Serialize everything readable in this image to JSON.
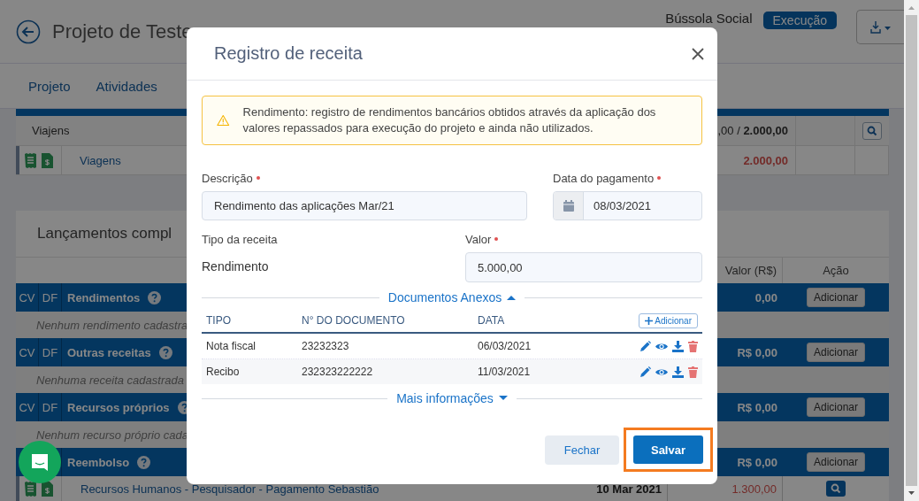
{
  "header": {
    "title": "Projeto de Teste",
    "organization": "Bússola Social",
    "status_badge": "Execução"
  },
  "tabs": [
    {
      "label": "Projeto",
      "selected": false
    },
    {
      "label": "Atividades",
      "selected": false
    }
  ],
  "budget_rows": [
    {
      "kind": "group",
      "label": "Viajens",
      "amount": ",00 / **2.000,00**"
    },
    {
      "kind": "item",
      "label": "Viagens",
      "amount": "2.000,00"
    }
  ],
  "launches": {
    "title": "Lançamentos compl",
    "columns": [
      "Valor (R$)",
      "Ação"
    ],
    "sections": [
      {
        "codes": [
          "CV",
          "DF"
        ],
        "name": "Rendimentos",
        "total": "0,00",
        "action": "Adicionar",
        "empty_text": "Nenhum rendimento cadastra"
      },
      {
        "codes": [
          "CV",
          "DF"
        ],
        "name": "Outras receitas",
        "total": "R$ 0,00",
        "action": "Adicionar",
        "empty_text": "Nenhuma receita cadastrada"
      },
      {
        "codes": [
          "CV",
          "DF"
        ],
        "name": "Recursos próprios",
        "total": "R$ 0,00",
        "action": "Adicionar",
        "empty_text": "Nenhum recurso próprio cada"
      },
      {
        "name": "Reembolso",
        "total": "R$ 0,00",
        "action": "Adicionar",
        "entries": [
          {
            "description": "Recursos Humanos - Pesquisador - Pagamento Sebastião",
            "date": "10 Mar 2021",
            "amount": "1.300,00"
          }
        ]
      }
    ]
  },
  "modal": {
    "title": "Registro de receita",
    "alert": "Rendimento: registro de rendimentos bancários obtidos através da aplicação dos valores repassados para execução do projeto e ainda não utilizados.",
    "description": {
      "label": "Descrição",
      "required": true,
      "value": "Rendimento das aplicações Mar/21"
    },
    "payment_date": {
      "label": "Data do pagamento",
      "required": true,
      "value": "08/03/2021"
    },
    "revenue_type": {
      "label": "Tipo da receita",
      "value": "Rendimento"
    },
    "amount": {
      "label": "Valor",
      "required": true,
      "value": "5.000,00"
    },
    "attachments": {
      "title": "Documentos Anexos",
      "expanded": true,
      "columns": [
        "TIPO",
        "N° DO DOCUMENTO",
        "DATA"
      ],
      "add_button": "Adicionar",
      "rows": [
        {
          "type": "Nota fiscal",
          "number": "23232323",
          "date": "06/03/2021"
        },
        {
          "type": "Recibo",
          "number": "232323222222",
          "date": "11/03/2021"
        }
      ]
    },
    "more_info": {
      "title": "Mais informações",
      "expanded": false
    },
    "close_button": "Fechar",
    "save_button": "Salvar",
    "save_highlighted": true
  }
}
